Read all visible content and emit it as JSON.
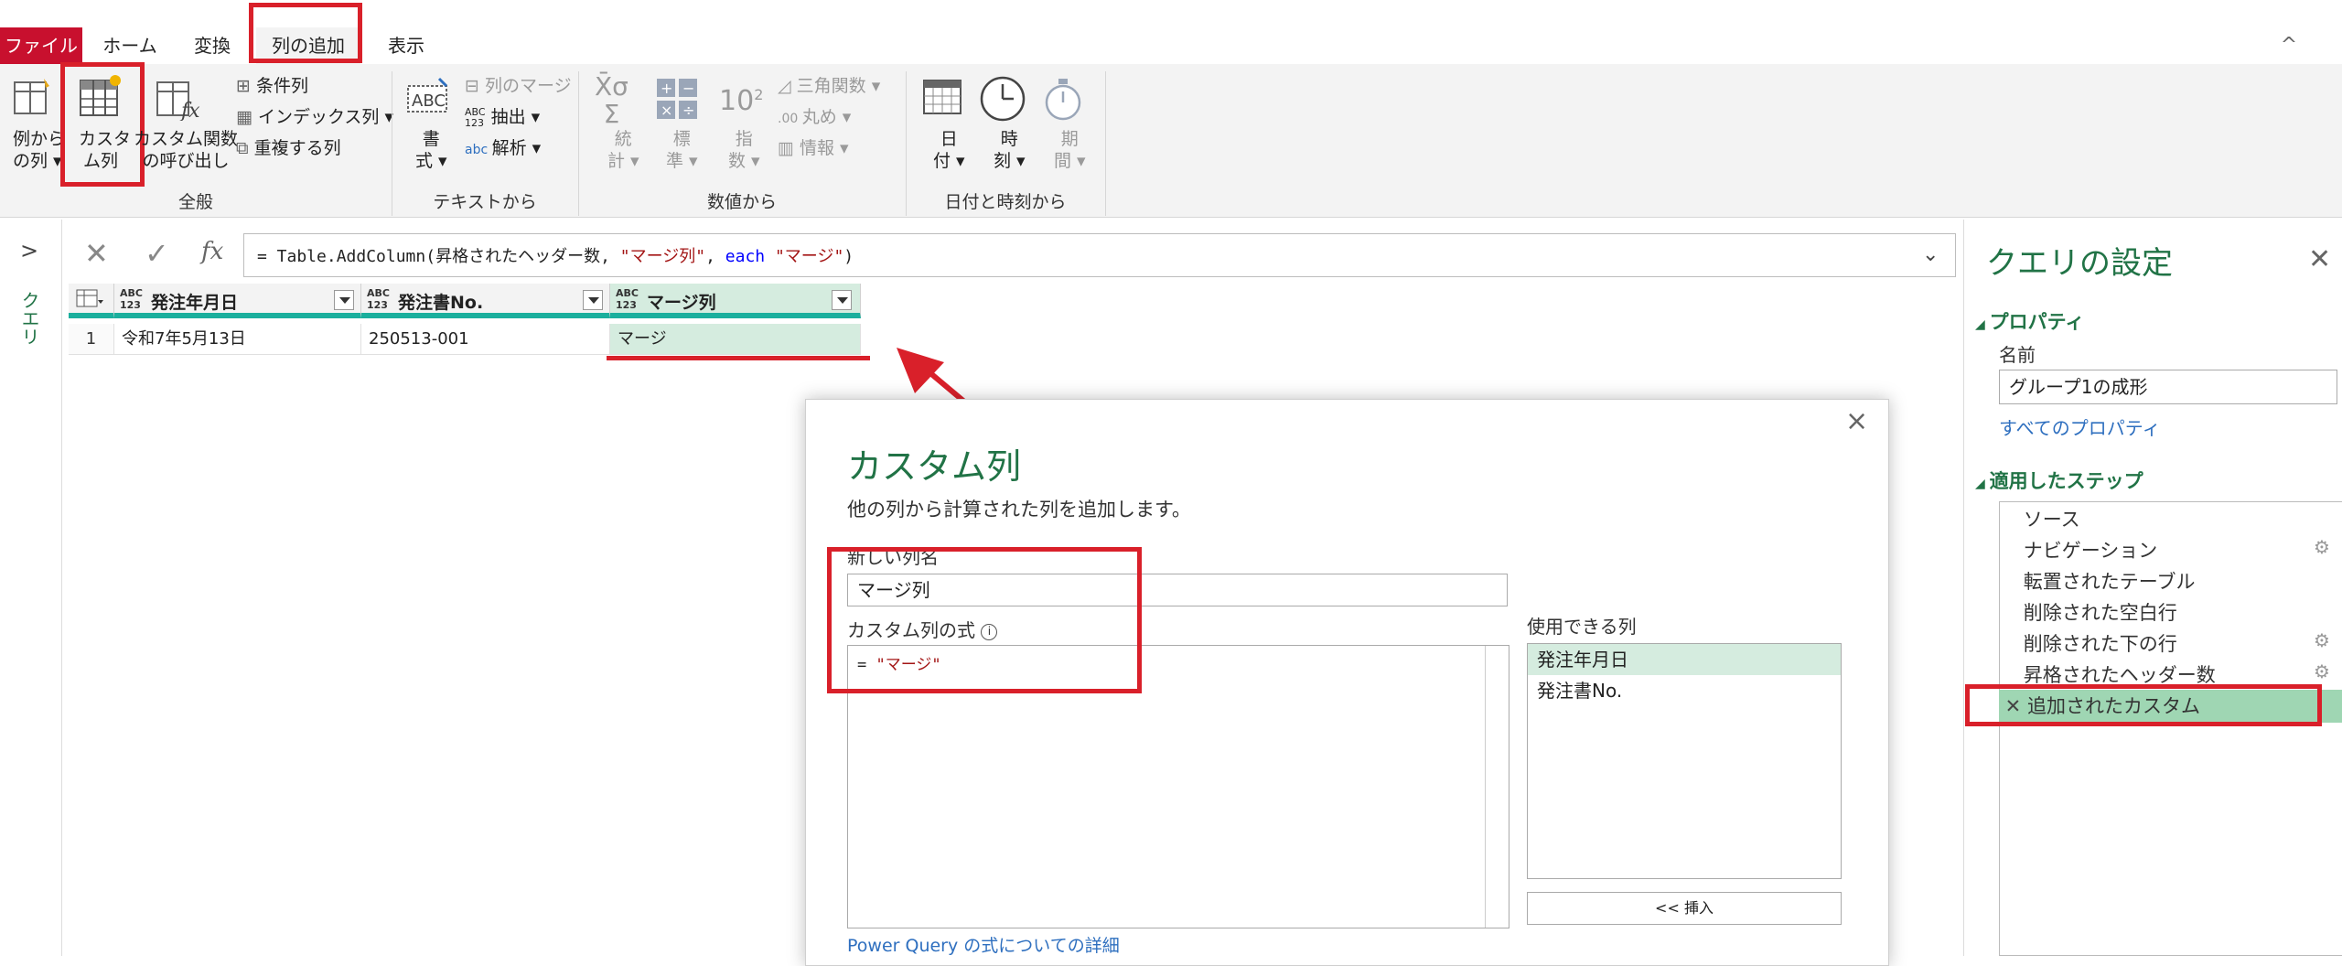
{
  "tabs": {
    "file": "ファイル",
    "home": "ホーム",
    "transform": "変換",
    "add_column": "列の追加",
    "view": "表示",
    "collapse": "^"
  },
  "ribbon": {
    "general": {
      "label": "全般",
      "example_col_1": "例から",
      "example_col_2": "の列",
      "custom_col_1": "カスタ",
      "custom_col_2": "ム列",
      "invoke_func_1": "カスタム関数",
      "invoke_func_2": "の呼び出し",
      "conditional": "条件列",
      "index": "インデックス列",
      "duplicate": "重複する列"
    },
    "text": {
      "label": "テキストから",
      "format_1": "書",
      "format_2": "式",
      "merge": "列のマージ",
      "extract": "抽出",
      "parse": "解析"
    },
    "number": {
      "label": "数値から",
      "stats_1": "統",
      "stats_2": "計",
      "std_1": "標",
      "std_2": "準",
      "sci_1": "指",
      "sci_2": "数",
      "trig": "三角関数",
      "round": "丸め",
      "info": "情報"
    },
    "datetime": {
      "label": "日付と時刻から",
      "date_1": "日",
      "date_2": "付",
      "time_1": "時",
      "time_2": "刻",
      "dur_1": "期",
      "dur_2": "間"
    }
  },
  "left_pane": {
    "expand": ">",
    "label": "クエリ"
  },
  "formula": {
    "prefix": "= Table.AddColumn(昇格されたヘッダー数, ",
    "str1": "\"マージ列\"",
    "mid": ", ",
    "kw": "each",
    "sp": " ",
    "str2": "\"マージ\"",
    "suffix": ")"
  },
  "table": {
    "type_label": "ABC\n123",
    "columns": [
      "発注年月日",
      "発注書No.",
      "マージ列"
    ],
    "rows": [
      {
        "num": "1",
        "cells": [
          "令和7年5月13日",
          "250513-001",
          "マージ"
        ]
      }
    ]
  },
  "dialog": {
    "title": "カスタム列",
    "subtitle": "他の列から計算された列を追加します。",
    "name_label": "新しい列名",
    "name_value": "マージ列",
    "formula_label": "カスタム列の式",
    "formula_eq": "= ",
    "formula_str": "\"マージ\"",
    "available_label": "使用できる列",
    "available": [
      "発注年月日",
      "発注書No."
    ],
    "insert": "<< 挿入",
    "link": "Power Query の式についての詳細"
  },
  "settings": {
    "title": "クエリの設定",
    "props_header": "プロパティ",
    "name_label": "名前",
    "name_value": "グループ1の成形",
    "all_props": "すべてのプロパティ",
    "steps_header": "適用したステップ",
    "steps": [
      "ソース",
      "ナビゲーション",
      "転置されたテーブル",
      "削除された空白行",
      "削除された下の行",
      "昇格されたヘッダー数",
      "追加されたカスタム"
    ]
  },
  "colors": {
    "accent": "#c8102e",
    "green": "#217346",
    "teal": "#1aaf9d",
    "highlight": "#d5ecdf",
    "red": "#d9202a"
  }
}
